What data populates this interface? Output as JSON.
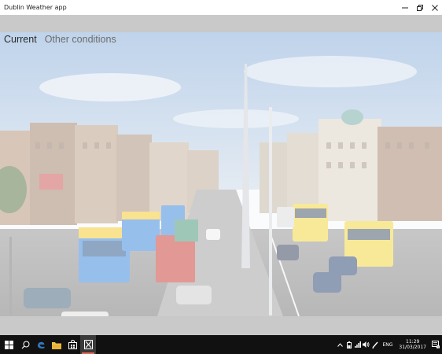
{
  "window": {
    "title": "Dublin Weather app",
    "buttons": [
      "minimize",
      "restore",
      "close"
    ]
  },
  "app": {
    "tabs": [
      {
        "label": "Current",
        "active": true
      },
      {
        "label": "Other conditions",
        "active": false
      }
    ],
    "background": "washed-out photo of O'Connell Street, Dublin with buses and the Spire"
  },
  "taskbar": {
    "pinned": [
      {
        "name": "start",
        "icon": "windows-logo-icon"
      },
      {
        "name": "search",
        "icon": "search-icon"
      },
      {
        "name": "edge",
        "icon": "edge-icon"
      },
      {
        "name": "file-explorer",
        "icon": "folder-icon"
      },
      {
        "name": "store",
        "icon": "store-bag-icon"
      },
      {
        "name": "weather-app",
        "icon": "app-x-icon"
      }
    ],
    "tray": {
      "icons": [
        "chevron-up-icon",
        "battery-icon",
        "network-icon",
        "volume-icon",
        "pen-icon"
      ],
      "language": "ENG",
      "time": "11:29",
      "date": "31/03/2017",
      "notification_count": "1"
    }
  },
  "colors": {
    "frame_grey": "#c9c9c9",
    "taskbar": "#111111",
    "active_indicator": "#e06b5a",
    "tab_active": "#2a2a2a",
    "tab_inactive": "#6d6d6d"
  }
}
